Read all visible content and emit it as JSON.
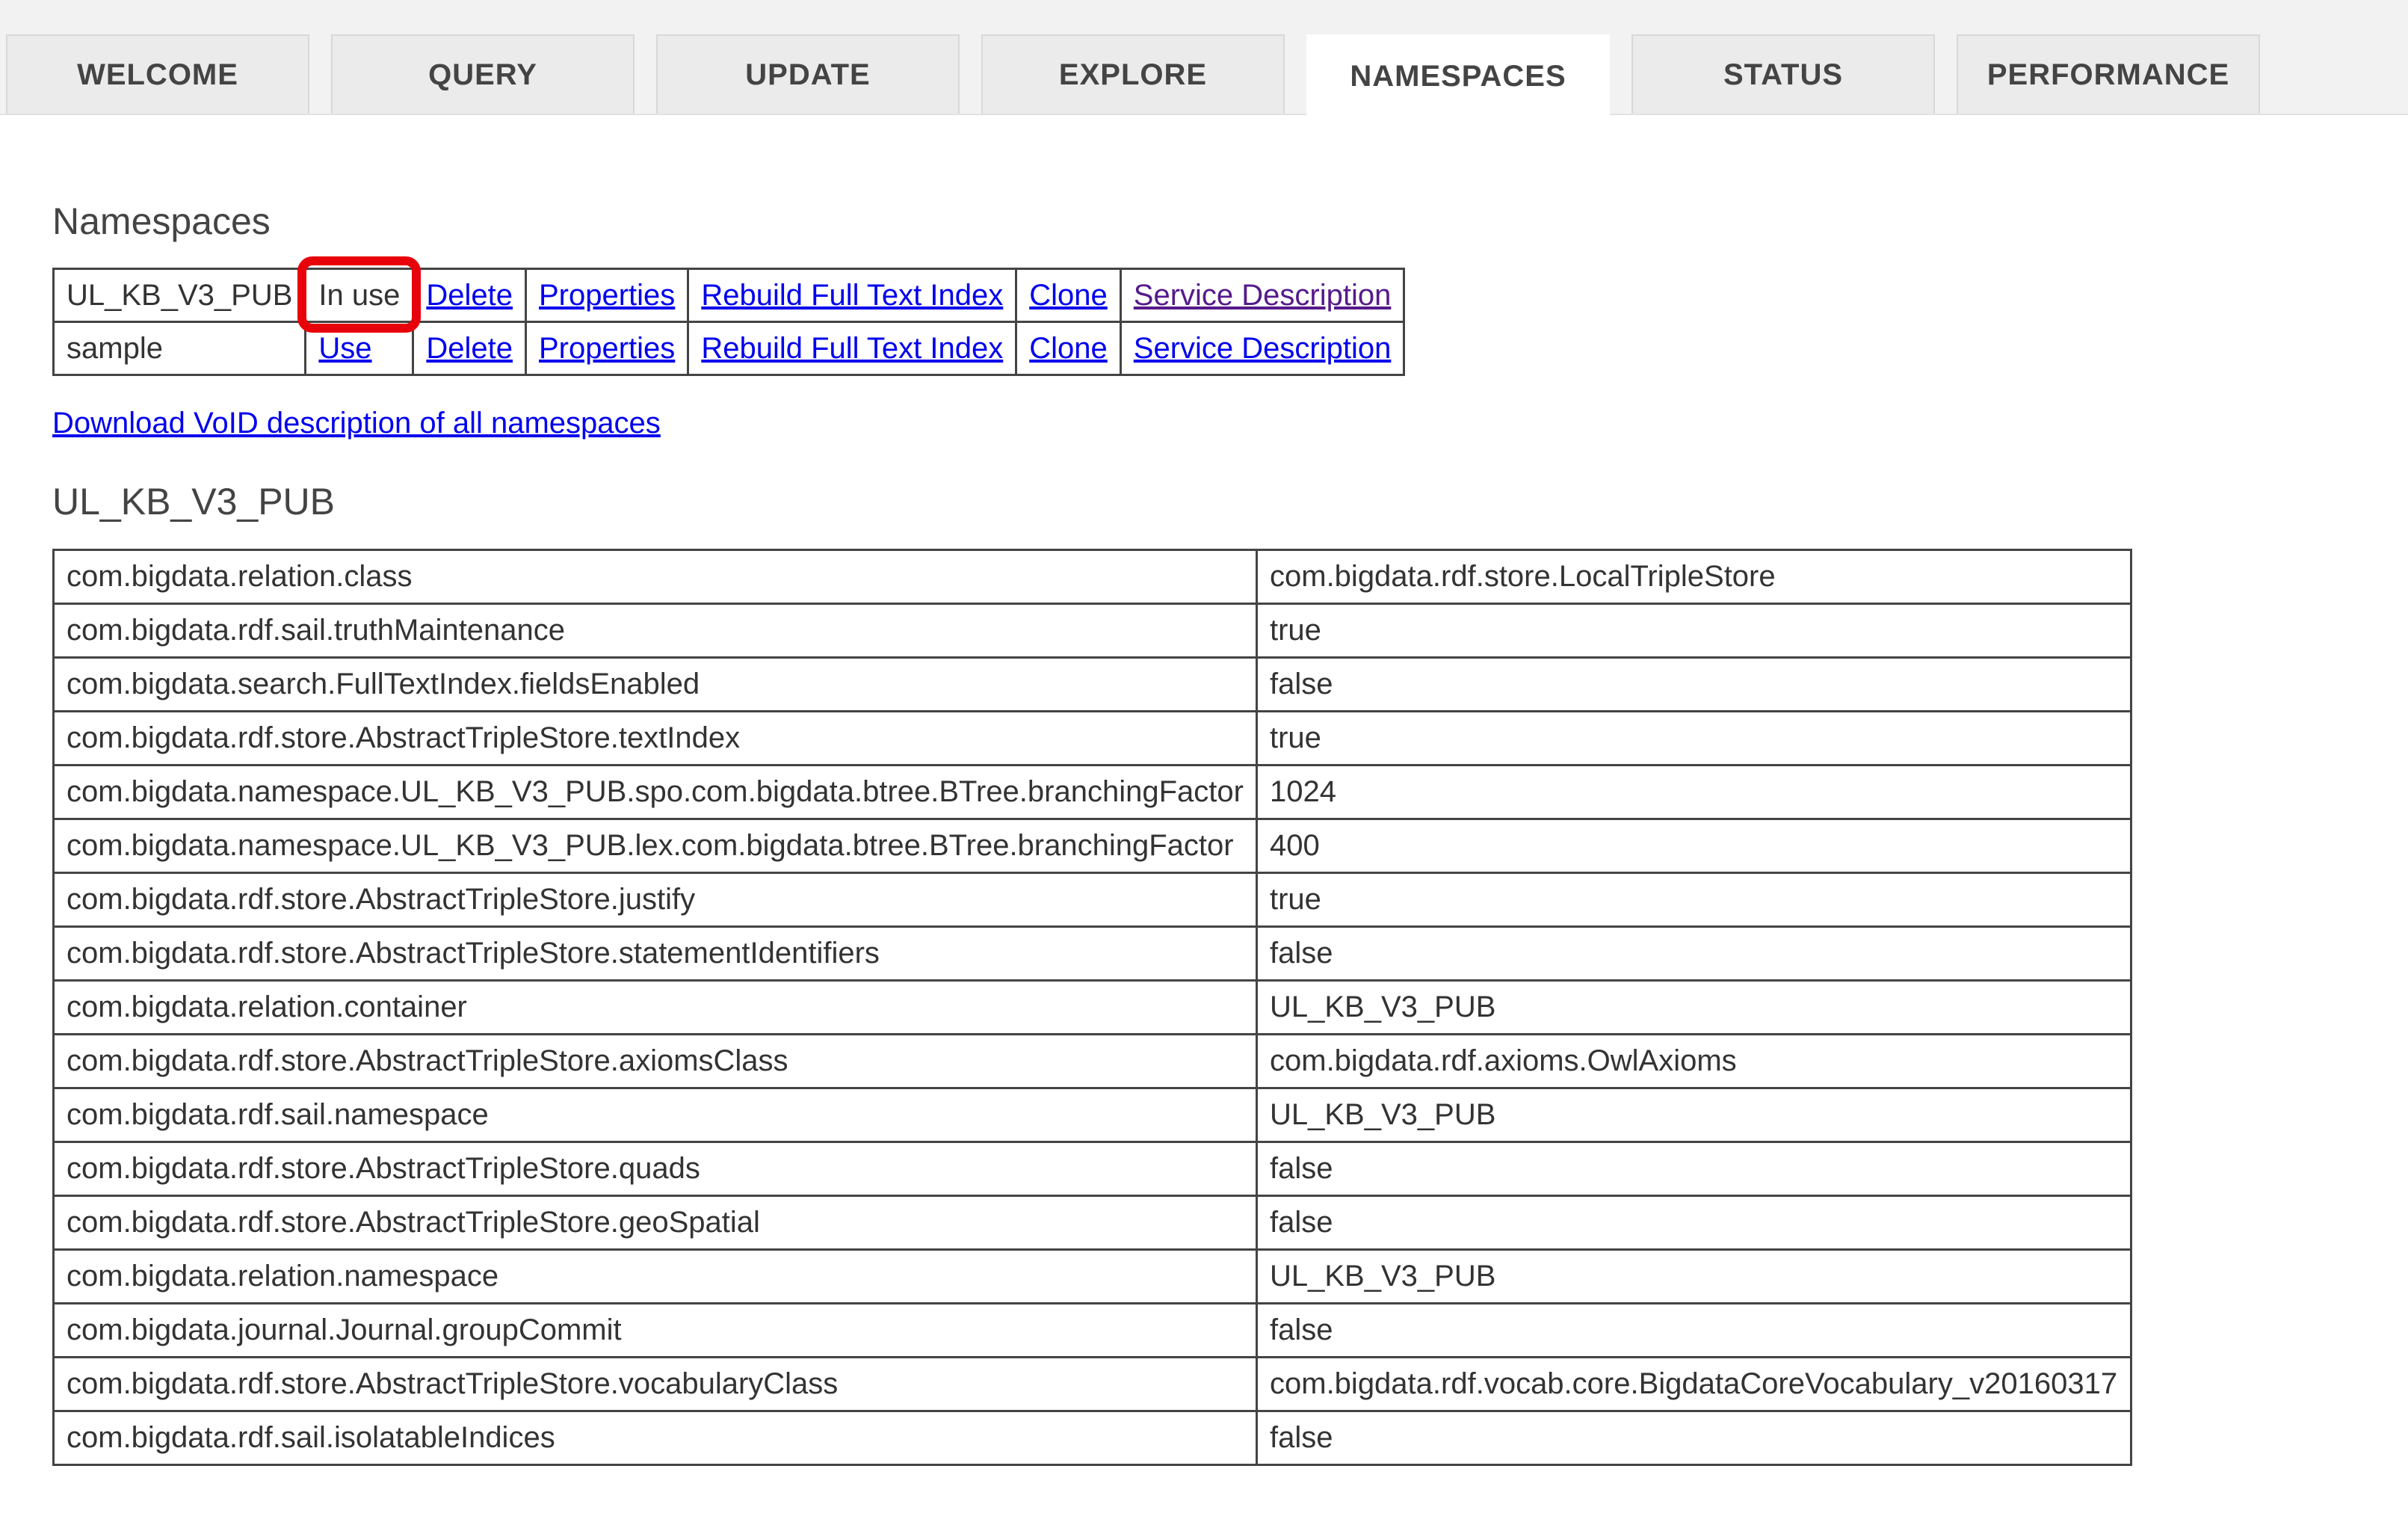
{
  "tabs": [
    {
      "label": "WELCOME"
    },
    {
      "label": "QUERY"
    },
    {
      "label": "UPDATE"
    },
    {
      "label": "EXPLORE"
    },
    {
      "label": "NAMESPACES",
      "active": true
    },
    {
      "label": "STATUS"
    },
    {
      "label": "PERFORMANCE"
    }
  ],
  "namespaces_heading": "Namespaces",
  "namespaces": [
    {
      "name": "UL_KB_V3_PUB",
      "status": "In use",
      "delete": "Delete",
      "properties": "Properties",
      "rebuild": "Rebuild Full Text Index",
      "clone": "Clone",
      "service": "Service Description"
    },
    {
      "name": "sample",
      "use": "Use",
      "delete": "Delete",
      "properties": "Properties",
      "rebuild": "Rebuild Full Text Index",
      "clone": "Clone",
      "service": "Service Description"
    }
  ],
  "download_link": "Download VoID description of all namespaces",
  "properties_heading": "UL_KB_V3_PUB",
  "properties": [
    {
      "key": "com.bigdata.relation.class",
      "value": "com.bigdata.rdf.store.LocalTripleStore"
    },
    {
      "key": "com.bigdata.rdf.sail.truthMaintenance",
      "value": "true"
    },
    {
      "key": "com.bigdata.search.FullTextIndex.fieldsEnabled",
      "value": "false"
    },
    {
      "key": "com.bigdata.rdf.store.AbstractTripleStore.textIndex",
      "value": "true"
    },
    {
      "key": "com.bigdata.namespace.UL_KB_V3_PUB.spo.com.bigdata.btree.BTree.branchingFactor",
      "value": "1024"
    },
    {
      "key": "com.bigdata.namespace.UL_KB_V3_PUB.lex.com.bigdata.btree.BTree.branchingFactor",
      "value": "400"
    },
    {
      "key": "com.bigdata.rdf.store.AbstractTripleStore.justify",
      "value": "true"
    },
    {
      "key": "com.bigdata.rdf.store.AbstractTripleStore.statementIdentifiers",
      "value": "false"
    },
    {
      "key": "com.bigdata.relation.container",
      "value": "UL_KB_V3_PUB"
    },
    {
      "key": "com.bigdata.rdf.store.AbstractTripleStore.axiomsClass",
      "value": "com.bigdata.rdf.axioms.OwlAxioms"
    },
    {
      "key": "com.bigdata.rdf.sail.namespace",
      "value": "UL_KB_V3_PUB"
    },
    {
      "key": "com.bigdata.rdf.store.AbstractTripleStore.quads",
      "value": "false"
    },
    {
      "key": "com.bigdata.rdf.store.AbstractTripleStore.geoSpatial",
      "value": "false"
    },
    {
      "key": "com.bigdata.relation.namespace",
      "value": "UL_KB_V3_PUB"
    },
    {
      "key": "com.bigdata.journal.Journal.groupCommit",
      "value": "false"
    },
    {
      "key": "com.bigdata.rdf.store.AbstractTripleStore.vocabularyClass",
      "value": "com.bigdata.rdf.vocab.core.BigdataCoreVocabulary_v20160317"
    },
    {
      "key": "com.bigdata.rdf.sail.isolatableIndices",
      "value": "false"
    }
  ],
  "colors": {
    "link": "#0000ee",
    "visited_link": "#551a8b",
    "highlight": "#e8000a"
  }
}
